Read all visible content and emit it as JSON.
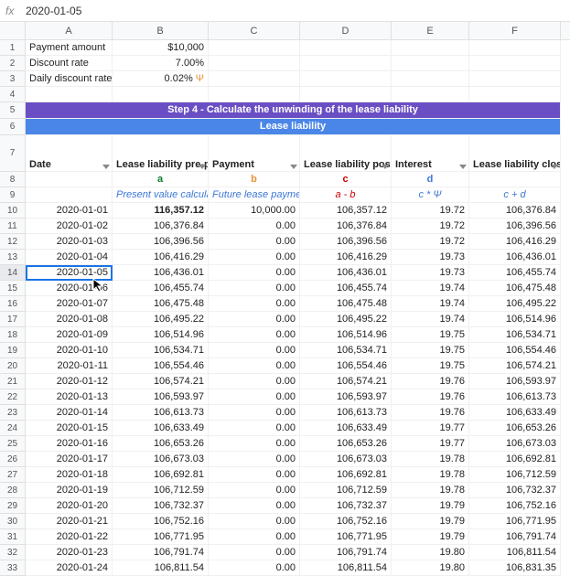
{
  "fx": {
    "label": "fx",
    "value": "2020-01-05"
  },
  "columns": [
    "A",
    "B",
    "C",
    "D",
    "E",
    "F"
  ],
  "labels": {
    "payment_amount": "Payment amount",
    "payment_amount_val": "$10,000",
    "discount_rate": "Discount rate",
    "discount_rate_val": "7.00%",
    "daily_rate": "Daily discount rate",
    "daily_rate_val": "0.02%",
    "psi": "Ψ",
    "step4": "Step 4 - Calculate the unwinding of the lease liability",
    "lease_liability": "Lease liability",
    "hdr": {
      "date": "Date",
      "pre": "Lease liability pre-payment",
      "payment": "Payment",
      "post": "Lease liability post-payment",
      "interest": "Interest",
      "closing": "Lease liability closing"
    },
    "letters": {
      "a": "a",
      "b": "b",
      "c": "c",
      "d": "d"
    },
    "formulas": {
      "pvc": "Present value calculation",
      "flp": "Future lease payments",
      "amb": "a - b",
      "cpsi": "c * Ψ",
      "cpd": "c + d"
    }
  },
  "chart_data": {
    "type": "table",
    "columns": [
      "Date",
      "Lease liability pre-payment",
      "Payment",
      "Lease liability post-payment",
      "Interest",
      "Lease liability closing"
    ],
    "rows": [
      [
        "2020-01-01",
        "116,357.12",
        "10,000.00",
        "106,357.12",
        "19.72",
        "106,376.84"
      ],
      [
        "2020-01-02",
        "106,376.84",
        "0.00",
        "106,376.84",
        "19.72",
        "106,396.56"
      ],
      [
        "2020-01-03",
        "106,396.56",
        "0.00",
        "106,396.56",
        "19.72",
        "106,416.29"
      ],
      [
        "2020-01-04",
        "106,416.29",
        "0.00",
        "106,416.29",
        "19.73",
        "106,436.01"
      ],
      [
        "2020-01-05",
        "106,436.01",
        "0.00",
        "106,436.01",
        "19.73",
        "106,455.74"
      ],
      [
        "2020-01-06",
        "106,455.74",
        "0.00",
        "106,455.74",
        "19.74",
        "106,475.48"
      ],
      [
        "2020-01-07",
        "106,475.48",
        "0.00",
        "106,475.48",
        "19.74",
        "106,495.22"
      ],
      [
        "2020-01-08",
        "106,495.22",
        "0.00",
        "106,495.22",
        "19.74",
        "106,514.96"
      ],
      [
        "2020-01-09",
        "106,514.96",
        "0.00",
        "106,514.96",
        "19.75",
        "106,534.71"
      ],
      [
        "2020-01-10",
        "106,534.71",
        "0.00",
        "106,534.71",
        "19.75",
        "106,554.46"
      ],
      [
        "2020-01-11",
        "106,554.46",
        "0.00",
        "106,554.46",
        "19.75",
        "106,574.21"
      ],
      [
        "2020-01-12",
        "106,574.21",
        "0.00",
        "106,574.21",
        "19.76",
        "106,593.97"
      ],
      [
        "2020-01-13",
        "106,593.97",
        "0.00",
        "106,593.97",
        "19.76",
        "106,613.73"
      ],
      [
        "2020-01-14",
        "106,613.73",
        "0.00",
        "106,613.73",
        "19.76",
        "106,633.49"
      ],
      [
        "2020-01-15",
        "106,633.49",
        "0.00",
        "106,633.49",
        "19.77",
        "106,653.26"
      ],
      [
        "2020-01-16",
        "106,653.26",
        "0.00",
        "106,653.26",
        "19.77",
        "106,673.03"
      ],
      [
        "2020-01-17",
        "106,673.03",
        "0.00",
        "106,673.03",
        "19.78",
        "106,692.81"
      ],
      [
        "2020-01-18",
        "106,692.81",
        "0.00",
        "106,692.81",
        "19.78",
        "106,712.59"
      ],
      [
        "2020-01-19",
        "106,712.59",
        "0.00",
        "106,712.59",
        "19.78",
        "106,732.37"
      ],
      [
        "2020-01-20",
        "106,732.37",
        "0.00",
        "106,732.37",
        "19.79",
        "106,752.16"
      ],
      [
        "2020-01-21",
        "106,752.16",
        "0.00",
        "106,752.16",
        "19.79",
        "106,771.95"
      ],
      [
        "2020-01-22",
        "106,771.95",
        "0.00",
        "106,771.95",
        "19.79",
        "106,791.74"
      ],
      [
        "2020-01-23",
        "106,791.74",
        "0.00",
        "106,791.74",
        "19.80",
        "106,811.54"
      ],
      [
        "2020-01-24",
        "106,811.54",
        "0.00",
        "106,811.54",
        "19.80",
        "106,831.35"
      ]
    ]
  },
  "selected_row_index": 4
}
